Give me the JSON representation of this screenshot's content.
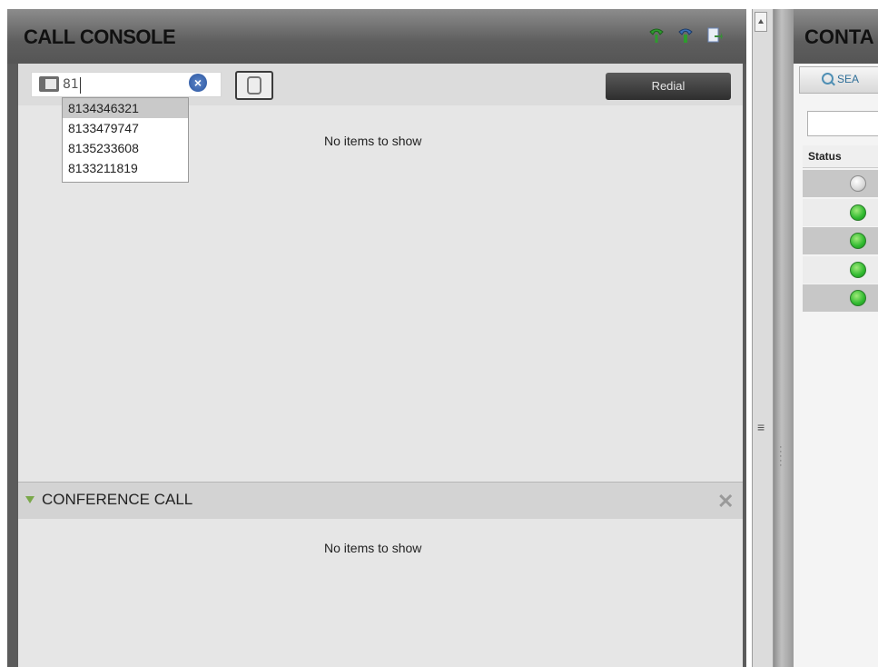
{
  "call_console": {
    "title": "CALL CONSOLE",
    "number_input": {
      "value": "81"
    },
    "redial_label": "Redial",
    "suggestions": [
      "8134346321",
      "8133479747",
      "8135233608",
      "8133211819"
    ],
    "empty_message": "No items to show"
  },
  "conference": {
    "title": "CONFERENCE CALL",
    "empty_message": "No items to show"
  },
  "contacts": {
    "title": "CONTA",
    "search_tab_label": "SEA",
    "status_column": "Status",
    "rows": [
      {
        "status": "offline"
      },
      {
        "status": "available"
      },
      {
        "status": "available"
      },
      {
        "status": "available"
      },
      {
        "status": "available"
      }
    ]
  },
  "colors": {
    "header_gradient_top": "#8c8c8c",
    "header_gradient_bottom": "#555555",
    "status_available": "#2fb92f",
    "status_offline": "#d5d5d5",
    "conference_arrow": "#7aa84a"
  }
}
